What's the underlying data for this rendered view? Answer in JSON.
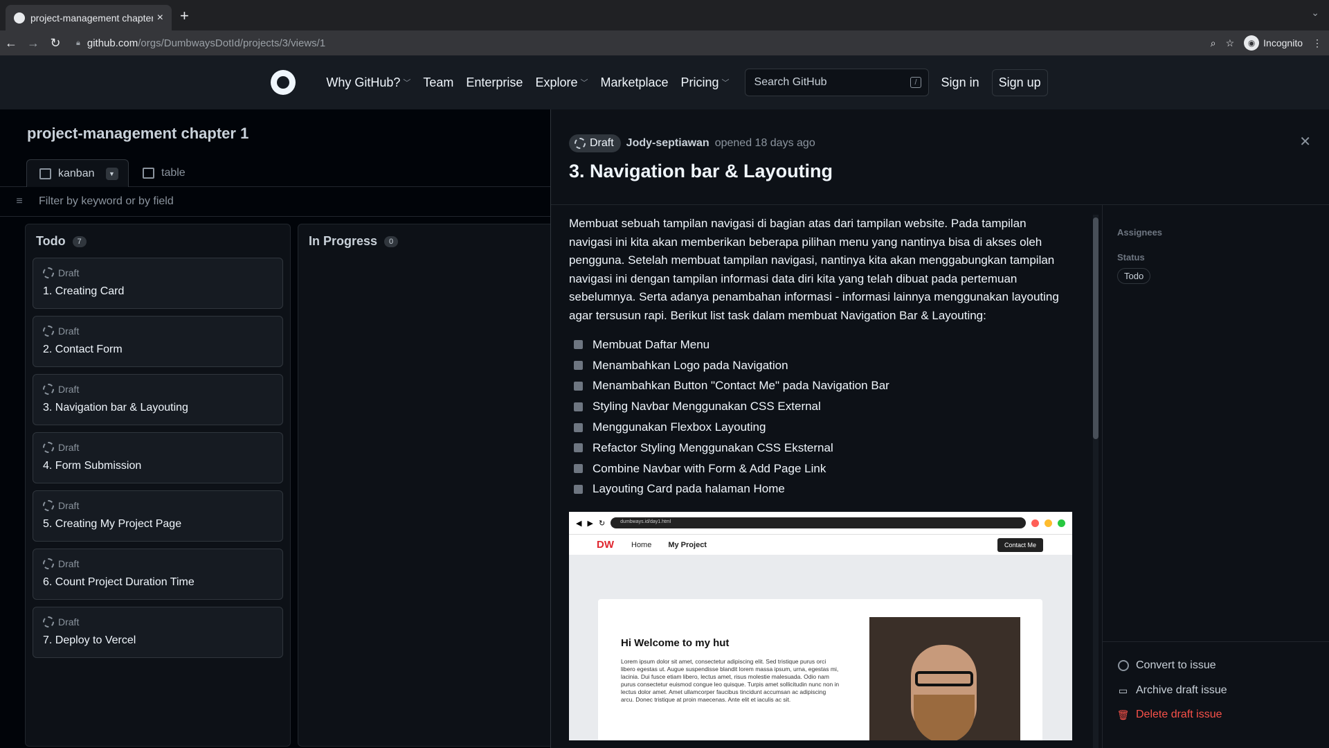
{
  "browser": {
    "tab_title": "project-management chapter 1",
    "url_domain": "github.com",
    "url_path": "/orgs/DumbwaysDotId/projects/3/views/1",
    "profile": "Incognito"
  },
  "header": {
    "nav": [
      "Why GitHub?",
      "Team",
      "Enterprise",
      "Explore",
      "Marketplace",
      "Pricing"
    ],
    "search_placeholder": "Search GitHub",
    "search_key": "/",
    "sign_in": "Sign in",
    "sign_up": "Sign up"
  },
  "project": {
    "title": "project-management chapter 1",
    "views": [
      {
        "label": "kanban"
      },
      {
        "label": "table"
      }
    ],
    "filter_placeholder": "Filter by keyword or by field",
    "columns": [
      {
        "name": "Todo",
        "count": "7",
        "cards": [
          {
            "status": "Draft",
            "title": "1. Creating Card"
          },
          {
            "status": "Draft",
            "title": "2. Contact Form"
          },
          {
            "status": "Draft",
            "title": "3. Navigation bar & Layouting"
          },
          {
            "status": "Draft",
            "title": "4. Form Submission"
          },
          {
            "status": "Draft",
            "title": "5. Creating My Project Page"
          },
          {
            "status": "Draft",
            "title": "6. Count Project Duration Time"
          },
          {
            "status": "Draft",
            "title": "7. Deploy to Vercel"
          }
        ]
      },
      {
        "name": "In Progress",
        "count": "0",
        "cards": []
      }
    ]
  },
  "detail": {
    "badge": "Draft",
    "author": "Jody-septiawan",
    "opened": "opened 18 days ago",
    "title": "3. Navigation bar & Layouting",
    "description": "Membuat sebuah tampilan navigasi di bagian atas dari tampilan website. Pada tampilan navigasi ini kita akan memberikan beberapa pilihan menu yang nantinya bisa di akses oleh pengguna. Setelah membuat tampilan navigasi, nantinya kita akan menggabungkan tampilan navigasi ini dengan tampilan informasi data diri kita yang telah dibuat pada pertemuan sebelumnya. Serta adanya penambahan informasi - informasi lainnya menggunakan layouting agar tersusun rapi. Berikut list task dalam membuat Navigation Bar & Layouting:",
    "tasks": [
      "Membuat Daftar Menu",
      "Menambahkan Logo pada Navigation",
      "Menambahkan Button \"Contact Me\" pada Navigation Bar",
      "Styling Navbar Menggunakan CSS External",
      "Menggunakan Flexbox Layouting",
      "Refactor Styling Menggunakan CSS Eksternal",
      "Combine Navbar with Form & Add Page Link",
      "Layouting Card pada halaman Home"
    ],
    "screenshot": {
      "url": "dumbways.id/day1.html",
      "logo": "DW",
      "nav": [
        "Home",
        "My Project"
      ],
      "button": "Contact Me",
      "heading": "Hi Welcome to my hut",
      "paragraph": "Lorem ipsum dolor sit amet, consectetur adipiscing elit. Sed tristique purus orci libero egestas ut. Augue suspendisse blandit lorem massa ipsum, urna, egestas mi, lacinia. Dui fusce etiam libero, lectus amet, risus molestie malesuada. Odio nam purus consectetur euismod congue leo quisque. Turpis amet sollicitudin nunc non in lectus dolor amet. Amet ullamcorper faucibus tincidunt accumsan ac adipiscing arcu. Donec tristique at proin maecenas. Ante elit et iaculis ac sit."
    }
  },
  "sidebar": {
    "assignees_label": "Assignees",
    "status_label": "Status",
    "status_value": "Todo",
    "actions": [
      {
        "label": "Convert to issue"
      },
      {
        "label": "Archive draft issue"
      },
      {
        "label": "Delete draft issue"
      }
    ]
  }
}
